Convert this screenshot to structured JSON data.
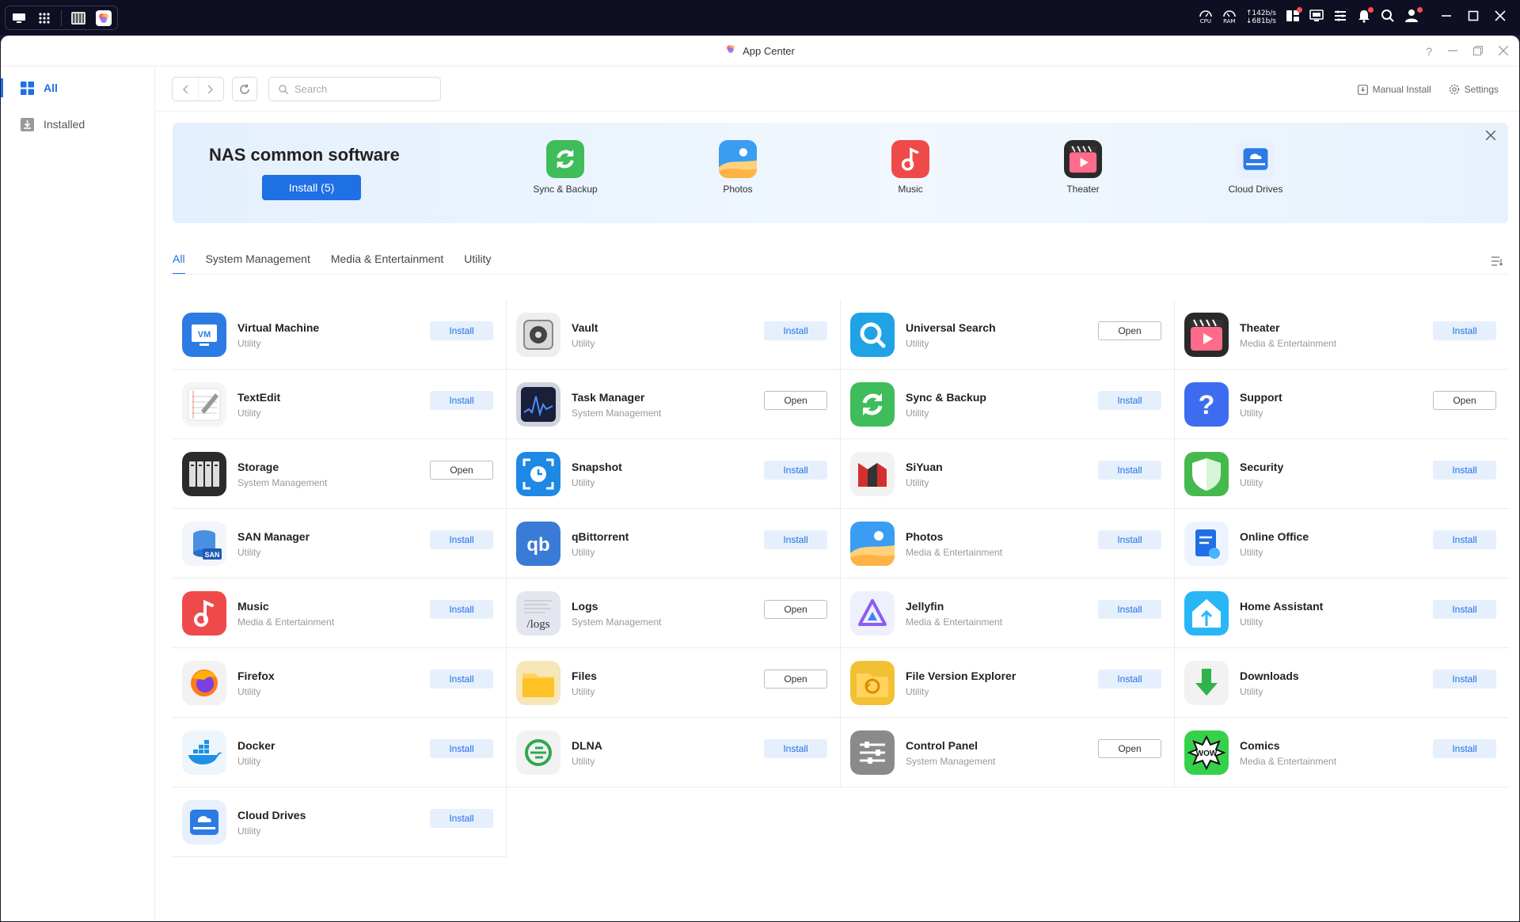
{
  "system_bar": {
    "cpu_label": "CPU",
    "ram_label": "RAM",
    "net_up": "↑142b/s",
    "net_down": "↓681b/s"
  },
  "window": {
    "title": "App Center",
    "help_label": "?"
  },
  "sidebar": {
    "items": [
      {
        "label": "All",
        "icon": "grid-icon"
      },
      {
        "label": "Installed",
        "icon": "download-icon"
      }
    ]
  },
  "toolbar": {
    "search_placeholder": "Search",
    "manual_install_label": "Manual Install",
    "settings_label": "Settings"
  },
  "banner": {
    "title": "NAS common software",
    "install_label": "Install (5)",
    "apps": [
      {
        "label": "Sync & Backup",
        "icon": "sync"
      },
      {
        "label": "Photos",
        "icon": "photos"
      },
      {
        "label": "Music",
        "icon": "music"
      },
      {
        "label": "Theater",
        "icon": "theater"
      },
      {
        "label": "Cloud Drives",
        "icon": "cloud"
      }
    ]
  },
  "tabs": [
    "All",
    "System Management",
    "Media & Entertainment",
    "Utility"
  ],
  "apps": [
    {
      "name": "Virtual Machine",
      "category": "Utility",
      "action": "Install",
      "icon": "vm"
    },
    {
      "name": "Vault",
      "category": "Utility",
      "action": "Install",
      "icon": "vault"
    },
    {
      "name": "Universal Search",
      "category": "Utility",
      "action": "Open",
      "icon": "search"
    },
    {
      "name": "Theater",
      "category": "Media & Entertainment",
      "action": "Install",
      "icon": "theater"
    },
    {
      "name": "TextEdit",
      "category": "Utility",
      "action": "Install",
      "icon": "textedit"
    },
    {
      "name": "Task Manager",
      "category": "System Management",
      "action": "Open",
      "icon": "taskmgr"
    },
    {
      "name": "Sync & Backup",
      "category": "Utility",
      "action": "Install",
      "icon": "sync"
    },
    {
      "name": "Support",
      "category": "Utility",
      "action": "Open",
      "icon": "support"
    },
    {
      "name": "Storage",
      "category": "System Management",
      "action": "Open",
      "icon": "storage"
    },
    {
      "name": "Snapshot",
      "category": "Utility",
      "action": "Install",
      "icon": "snapshot"
    },
    {
      "name": "SiYuan",
      "category": "Utility",
      "action": "Install",
      "icon": "siyuan"
    },
    {
      "name": "Security",
      "category": "Utility",
      "action": "Install",
      "icon": "security"
    },
    {
      "name": "SAN Manager",
      "category": "Utility",
      "action": "Install",
      "icon": "san"
    },
    {
      "name": "qBittorrent",
      "category": "Utility",
      "action": "Install",
      "icon": "qb"
    },
    {
      "name": "Photos",
      "category": "Media & Entertainment",
      "action": "Install",
      "icon": "photos"
    },
    {
      "name": "Online Office",
      "category": "Utility",
      "action": "Install",
      "icon": "office"
    },
    {
      "name": "Music",
      "category": "Media & Entertainment",
      "action": "Install",
      "icon": "music"
    },
    {
      "name": "Logs",
      "category": "System Management",
      "action": "Open",
      "icon": "logs"
    },
    {
      "name": "Jellyfin",
      "category": "Media & Entertainment",
      "action": "Install",
      "icon": "jellyfin"
    },
    {
      "name": "Home Assistant",
      "category": "Utility",
      "action": "Install",
      "icon": "home"
    },
    {
      "name": "Firefox",
      "category": "Utility",
      "action": "Install",
      "icon": "firefox"
    },
    {
      "name": "Files",
      "category": "Utility",
      "action": "Open",
      "icon": "files"
    },
    {
      "name": "File Version Explorer",
      "category": "Utility",
      "action": "Install",
      "icon": "fve"
    },
    {
      "name": "Downloads",
      "category": "Utility",
      "action": "Install",
      "icon": "downloads"
    },
    {
      "name": "Docker",
      "category": "Utility",
      "action": "Install",
      "icon": "docker"
    },
    {
      "name": "DLNA",
      "category": "Utility",
      "action": "Install",
      "icon": "dlna"
    },
    {
      "name": "Control Panel",
      "category": "System Management",
      "action": "Open",
      "icon": "control"
    },
    {
      "name": "Comics",
      "category": "Media & Entertainment",
      "action": "Install",
      "icon": "comics"
    },
    {
      "name": "Cloud Drives",
      "category": "Utility",
      "action": "Install",
      "icon": "cloud"
    }
  ],
  "icon_text": {
    "vm": "VM",
    "qb": "qb",
    "logs": "/logs",
    "san": "SAN",
    "wow": "WOW"
  },
  "colors": {
    "accent": "#1f6fe5",
    "install_bg": "#e6f0fd"
  }
}
